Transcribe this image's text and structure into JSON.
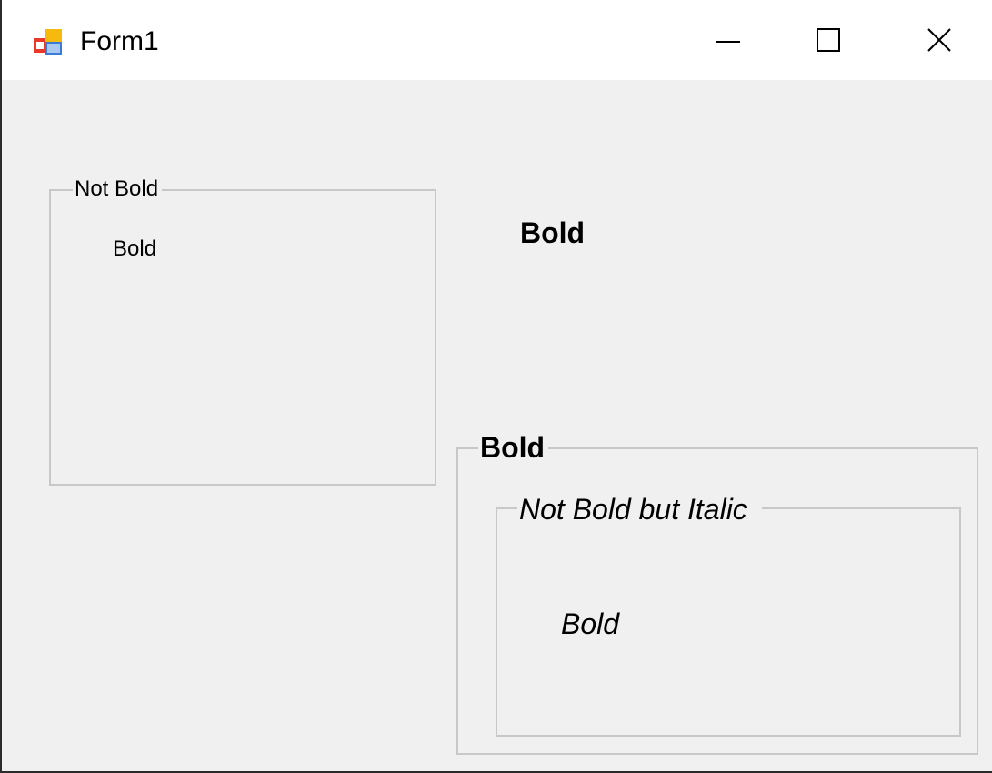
{
  "window": {
    "title": "Form1",
    "icon": "winforms-app-icon",
    "caption_buttons": {
      "minimize": "minimize-icon",
      "maximize": "maximize-icon",
      "close": "close-icon"
    }
  },
  "form": {
    "groupbox_left": {
      "caption": "Not Bold",
      "label": "Bold"
    },
    "label_right": "Bold",
    "groupbox_outer": {
      "caption": "Bold",
      "groupbox_inner": {
        "caption": "Not Bold but Italic",
        "label": "Bold"
      }
    }
  },
  "colors": {
    "client_background": "#f0f0f0",
    "groupbox_border": "#c8c8c8",
    "title_background": "#ffffff"
  }
}
